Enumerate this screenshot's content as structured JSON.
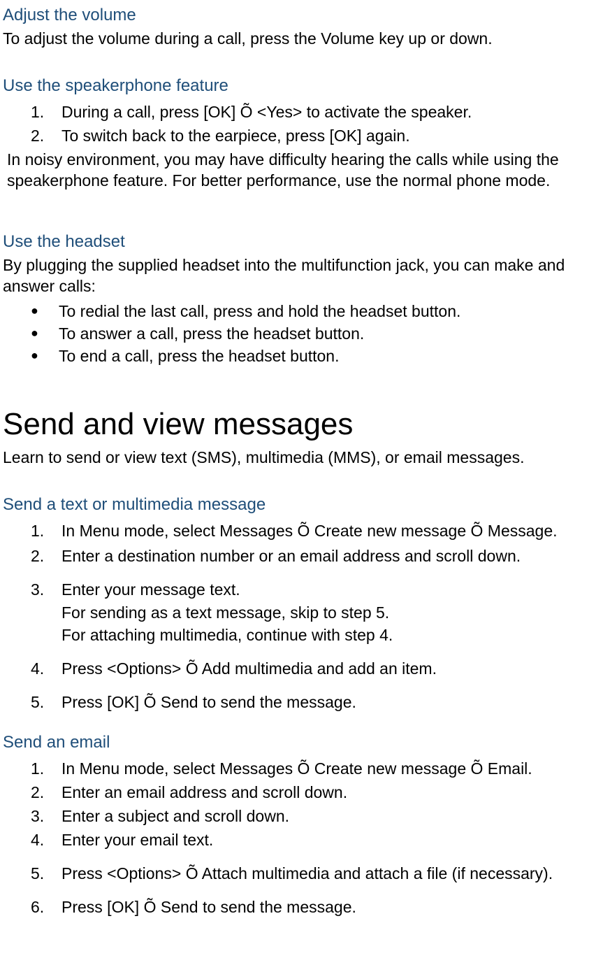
{
  "s1": {
    "heading": "Adjust the volume",
    "body": "To adjust the volume during a call, press the Volume key up or down."
  },
  "s2": {
    "heading": "Use the speakerphone feature",
    "steps": [
      "During a call, press [OK] Õ <Yes> to activate the speaker.",
      "To switch back to the earpiece, press [OK] again."
    ],
    "note": "In noisy environment, you may have difficulty hearing the calls while using the speakerphone feature. For better performance, use the normal phone mode."
  },
  "s3": {
    "heading": "Use the headset",
    "body": "By plugging the supplied headset into the multifunction jack, you can make and answer calls:",
    "bullets": [
      "To redial the last call, press and hold the headset button.",
      "To answer a call, press the headset button.",
      "To end a call, press the headset button."
    ]
  },
  "main": {
    "heading": "Send and view messages",
    "body": "Learn to send or view text (SMS), multimedia (MMS), or email messages."
  },
  "s4": {
    "heading": "Send a text or multimedia message",
    "steps": [
      "In Menu mode, select Messages Õ Create new message Õ Message.",
      "Enter a destination number or an email address and scroll down.",
      "Enter your message text.",
      "Press <Options> Õ Add multimedia and add an item.",
      "Press [OK] Õ Send to send the message."
    ],
    "step3_sub1": "For sending as a text message, skip to step 5.",
    "step3_sub2": "For attaching multimedia, continue with step 4."
  },
  "s5": {
    "heading": "Send an email",
    "steps": [
      "In Menu mode, select Messages Õ Create new message Õ Email.",
      "Enter an email address and scroll down.",
      "Enter a subject and scroll down.",
      "Enter your email text.",
      "Press <Options> Õ Attach multimedia and attach a file (if necessary).",
      "Press [OK] Õ Send to send the message."
    ]
  }
}
